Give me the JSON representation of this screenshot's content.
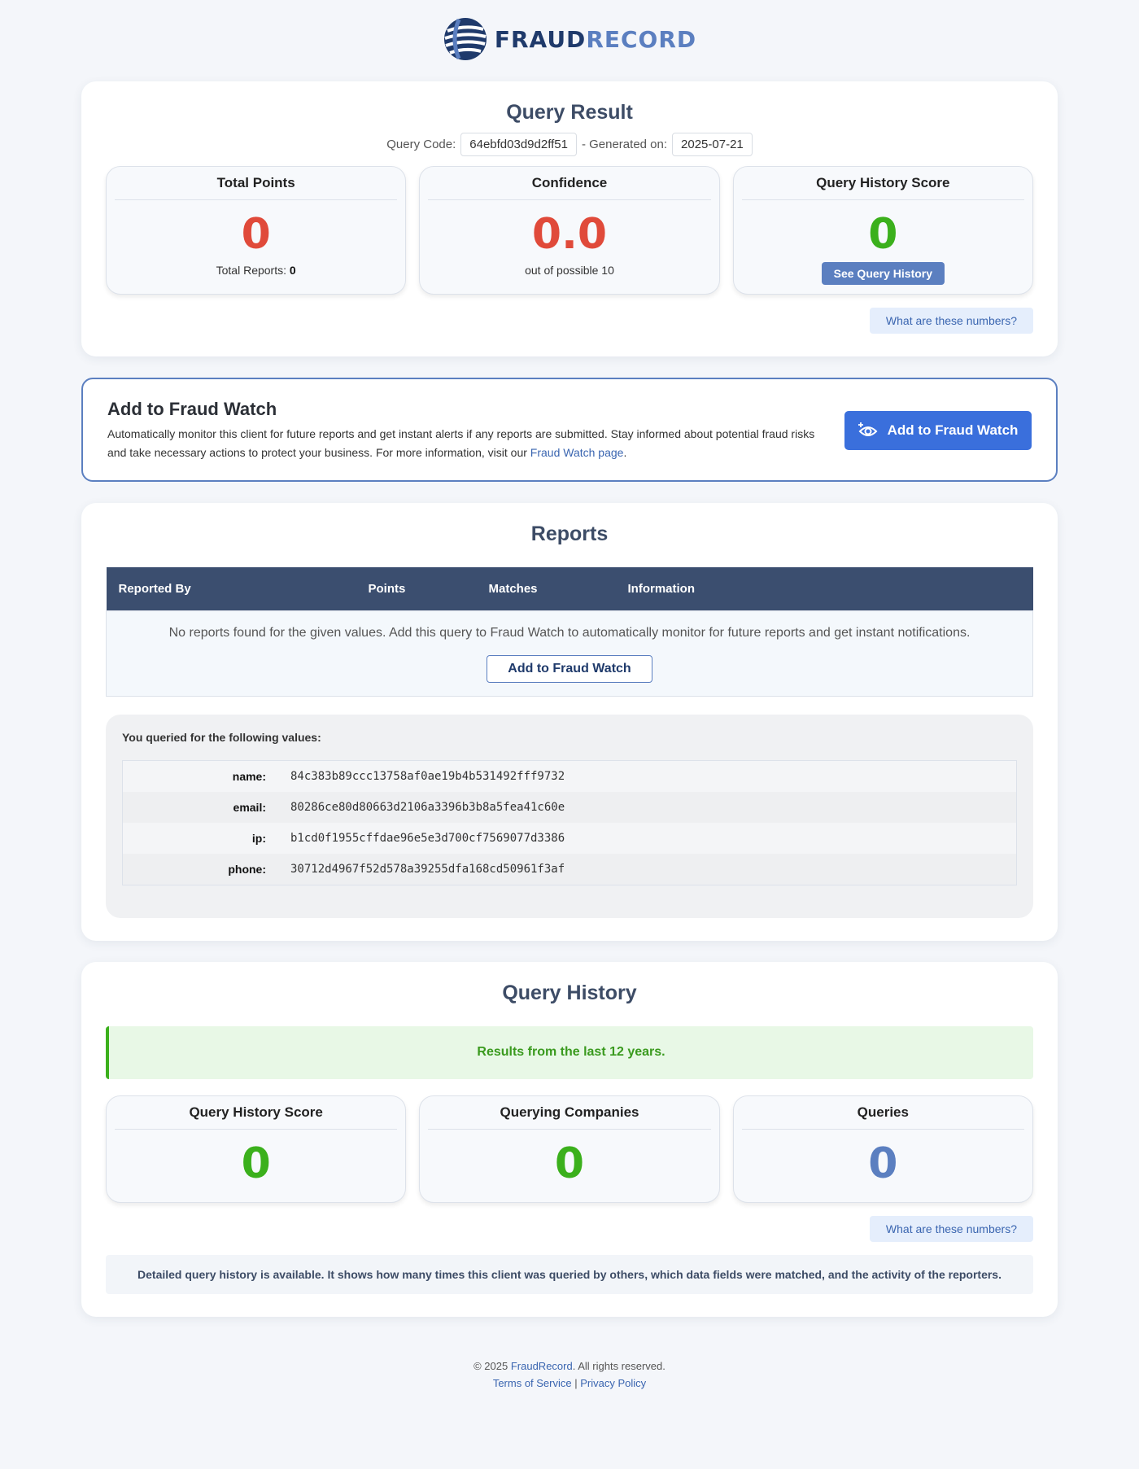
{
  "brand": {
    "name_part1": "FRAUD",
    "name_part2": "RECORD",
    "logo_icon": "globe-logo-icon"
  },
  "query_result": {
    "title": "Query Result",
    "query_code_label": "Query Code:",
    "query_code": "64ebfd03d9d2ff51",
    "generated_label": "- Generated on:",
    "generated_on": "2025-07-21",
    "stats": {
      "total_points_label": "Total Points",
      "total_points": "0",
      "total_reports_label": "Total Reports:",
      "total_reports": "0",
      "confidence_label": "Confidence",
      "confidence": "0.0",
      "confidence_sub": "out of possible 10",
      "history_score_label": "Query History Score",
      "history_score": "0",
      "see_history_button": "See Query History"
    },
    "what_button": "What are these numbers?"
  },
  "fraud_watch": {
    "title": "Add to Fraud Watch",
    "description": "Automatically monitor this client for future reports and get instant alerts if any reports are submitted. Stay informed about potential fraud risks and take necessary actions to protect your business. For more information, visit our ",
    "link_text": "Fraud Watch page",
    "link_suffix": ".",
    "button_label": "Add to Fraud Watch",
    "button_icon": "eye-plus-icon",
    "accent": "#3a6fdc"
  },
  "reports": {
    "title": "Reports",
    "columns": [
      "Reported By",
      "Points",
      "Matches",
      "Information"
    ],
    "empty_text": "No reports found for the given values. Add this query to Fraud Watch to automatically monitor for future reports and get instant notifications.",
    "empty_button": "Add to Fraud Watch",
    "queried_title": "You queried for the following values:",
    "queried_values": [
      {
        "key": "name:",
        "value": "84c383b89ccc13758af0ae19b4b531492fff9732"
      },
      {
        "key": "email:",
        "value": "80286ce80d80663d2106a3396b3b8a5fea41c60e"
      },
      {
        "key": "ip:",
        "value": "b1cd0f1955cffdae96e5e3d700cf7569077d3386"
      },
      {
        "key": "phone:",
        "value": "30712d4967f52d578a39255dfa168cd50961f3af"
      }
    ]
  },
  "query_history": {
    "title": "Query History",
    "notice": "Results from the last 12 years.",
    "history_score_label": "Query History Score",
    "history_score": "0",
    "companies_label": "Querying Companies",
    "companies": "0",
    "queries_label": "Queries",
    "queries": "0",
    "what_button": "What are these numbers?",
    "info": "Detailed query history is available. It shows how many times this client was queried by others, which data fields were matched, and the activity of the reporters."
  },
  "footer": {
    "copyright_prefix": "© 2025 ",
    "brand_link": "FraudRecord",
    "copyright_suffix": ". All rights reserved.",
    "terms": "Terms of Service",
    "separator": "|",
    "privacy": "Privacy Policy"
  }
}
